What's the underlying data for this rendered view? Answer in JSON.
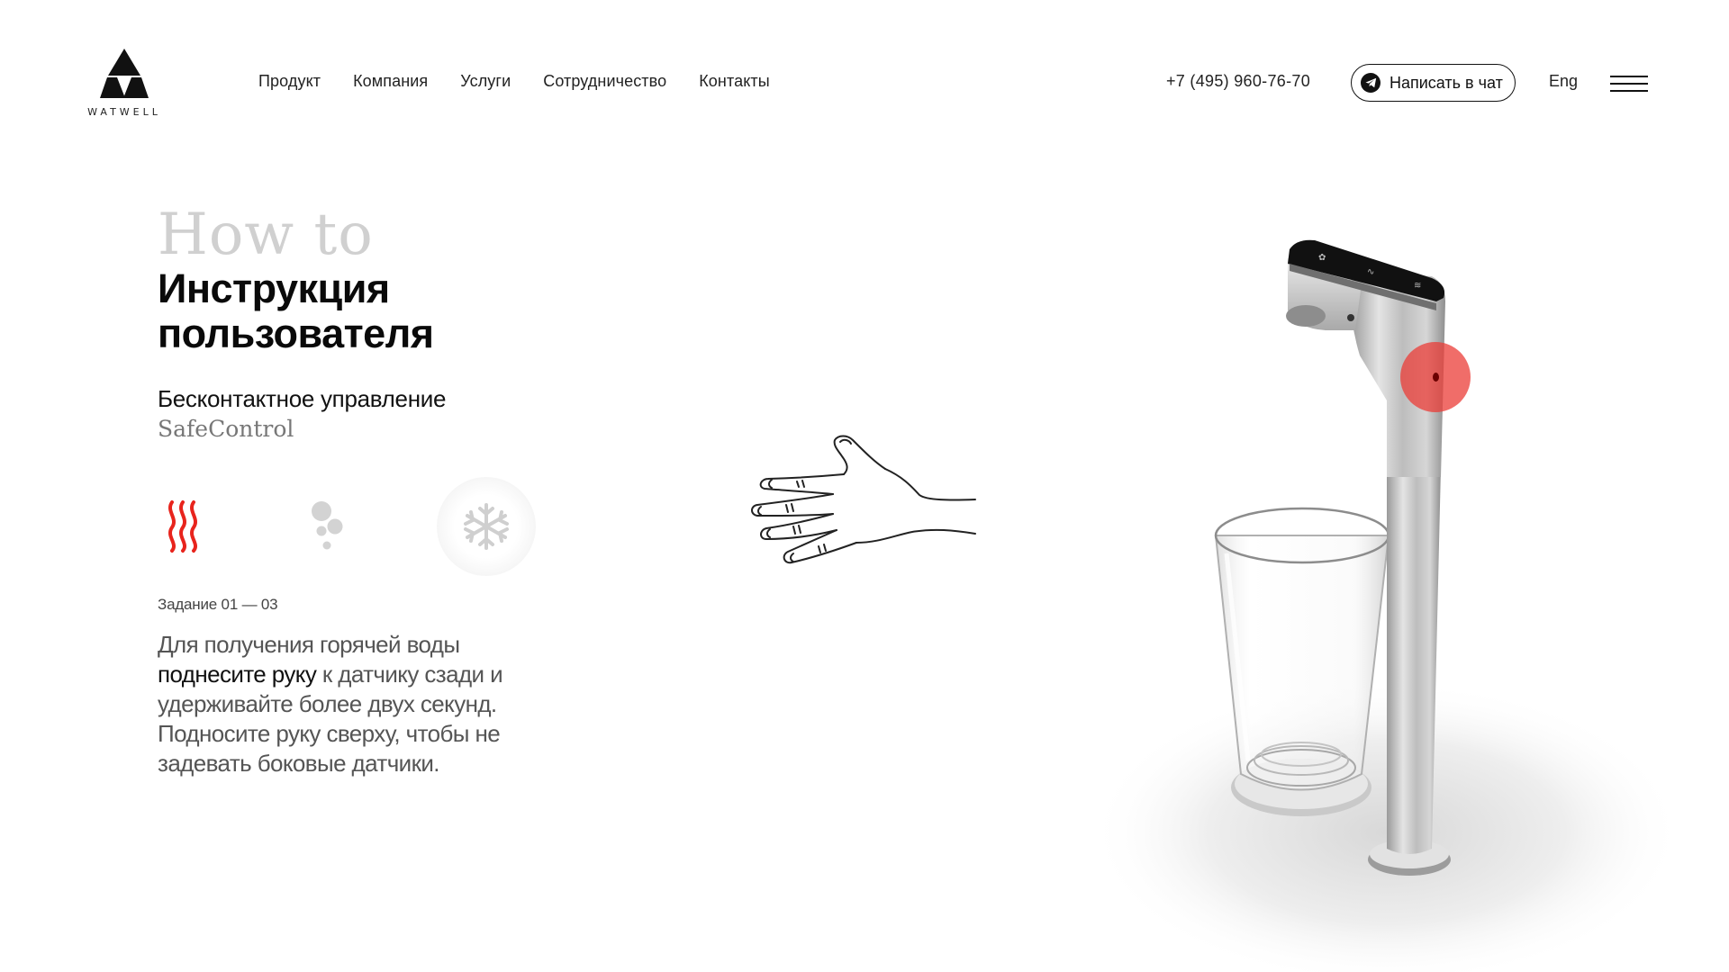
{
  "brand": {
    "name": "WATWELL"
  },
  "nav": {
    "items": [
      {
        "label": "Продукт"
      },
      {
        "label": "Компания"
      },
      {
        "label": "Услуги"
      },
      {
        "label": "Сотрудничество"
      },
      {
        "label": "Контакты"
      }
    ]
  },
  "header": {
    "phone": "+7 (495) 960-76-70",
    "chat_label": "Написать в чат",
    "lang": "Eng"
  },
  "hero": {
    "overline": "How to",
    "title_line1": "Инструкция",
    "title_line2": "пользователя",
    "subtitle": "Бесконтактное управление",
    "subtitle_brand": "SafeControl"
  },
  "modes": [
    {
      "icon": "hot-water-icon",
      "color": "#e8241d",
      "active": true
    },
    {
      "icon": "sparkling-water-icon",
      "color": "#cfcfcf",
      "active": false
    },
    {
      "icon": "cold-water-icon",
      "color": "#cfcfcf",
      "active": false
    }
  ],
  "task": {
    "label": "Задание 01 — 03",
    "text_part1": "Для получения горячей воды",
    "text_highlight": "поднесите руку",
    "text_part2": "к датчику сзади и удерживайте более двух секунд. Подносите руку сверху, чтобы не задевать боковые датчики."
  },
  "colors": {
    "accent": "#e8241d",
    "sensor": "#eb3c37",
    "text_muted": "#555555",
    "overline": "#d0d0d0"
  },
  "icons": [
    "logo-icon",
    "telegram-icon",
    "menu-icon",
    "hand-illustration",
    "sensor-marker"
  ]
}
